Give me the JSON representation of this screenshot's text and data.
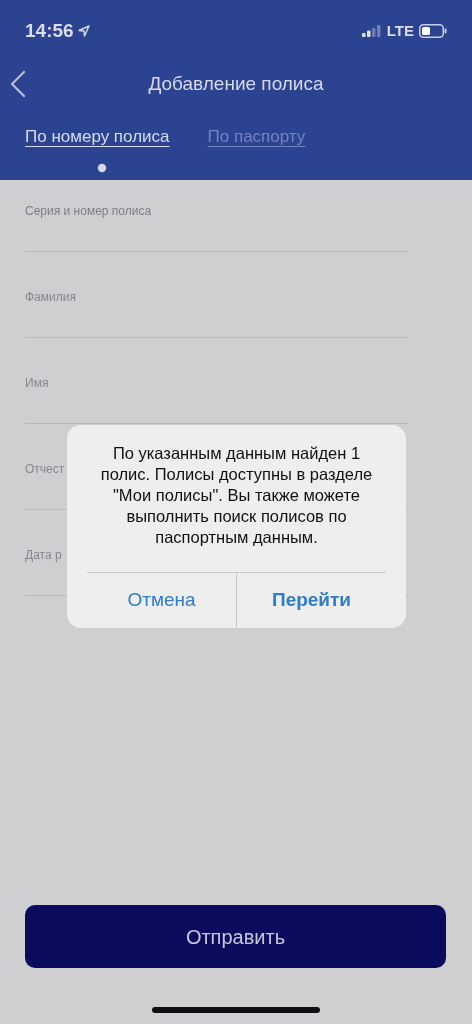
{
  "status_bar": {
    "time": "14:56",
    "network": "LTE"
  },
  "header": {
    "title": "Добавление полиса"
  },
  "tabs": [
    {
      "label": "По номеру полиса",
      "selected": true
    },
    {
      "label": "По паспорту",
      "selected": false
    }
  ],
  "fields": [
    {
      "label": "Серия и номер полиса"
    },
    {
      "label": "Фамилия"
    },
    {
      "label": "Имя"
    },
    {
      "label": "Отчест"
    },
    {
      "label": "Дата р"
    }
  ],
  "submit_button": "Отправить",
  "dialog": {
    "message": "По указанным данным найден 1 полис. Полисы доступны в разделе \"Мои полисы\". Вы также можете выполнить поиск полисов по паспортным данным.",
    "buttons": [
      {
        "label": "Отмена",
        "primary": false
      },
      {
        "label": "Перейти",
        "primary": true
      }
    ]
  }
}
